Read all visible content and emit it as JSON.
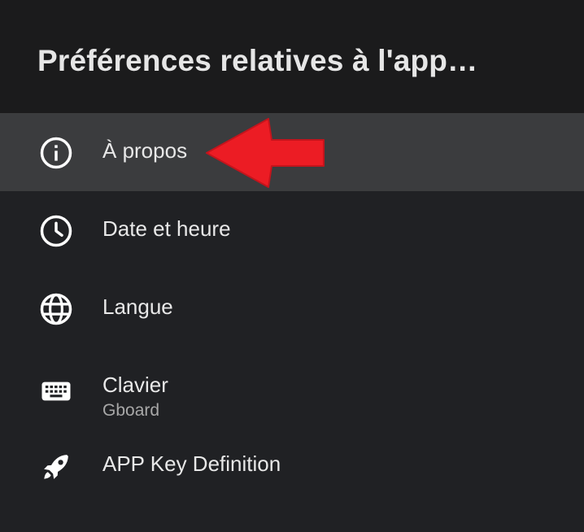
{
  "header": {
    "title": "Préférences relatives à l'app…"
  },
  "menu": {
    "items": [
      {
        "label": "À propos",
        "icon": "info-icon",
        "selected": true
      },
      {
        "label": "Date et heure",
        "icon": "clock-icon"
      },
      {
        "label": "Langue",
        "icon": "globe-icon"
      },
      {
        "label": "Clavier",
        "sublabel": "Gboard",
        "icon": "keyboard-icon"
      },
      {
        "label": "APP Key Definition",
        "icon": "rocket-icon"
      }
    ]
  },
  "colors": {
    "background": "#202124",
    "header_background": "#1b1b1c",
    "selected_row": "#3b3c3e",
    "text": "#e8e8e8",
    "subtext": "#a8a8a8",
    "annotation_arrow": "#e8202a"
  }
}
